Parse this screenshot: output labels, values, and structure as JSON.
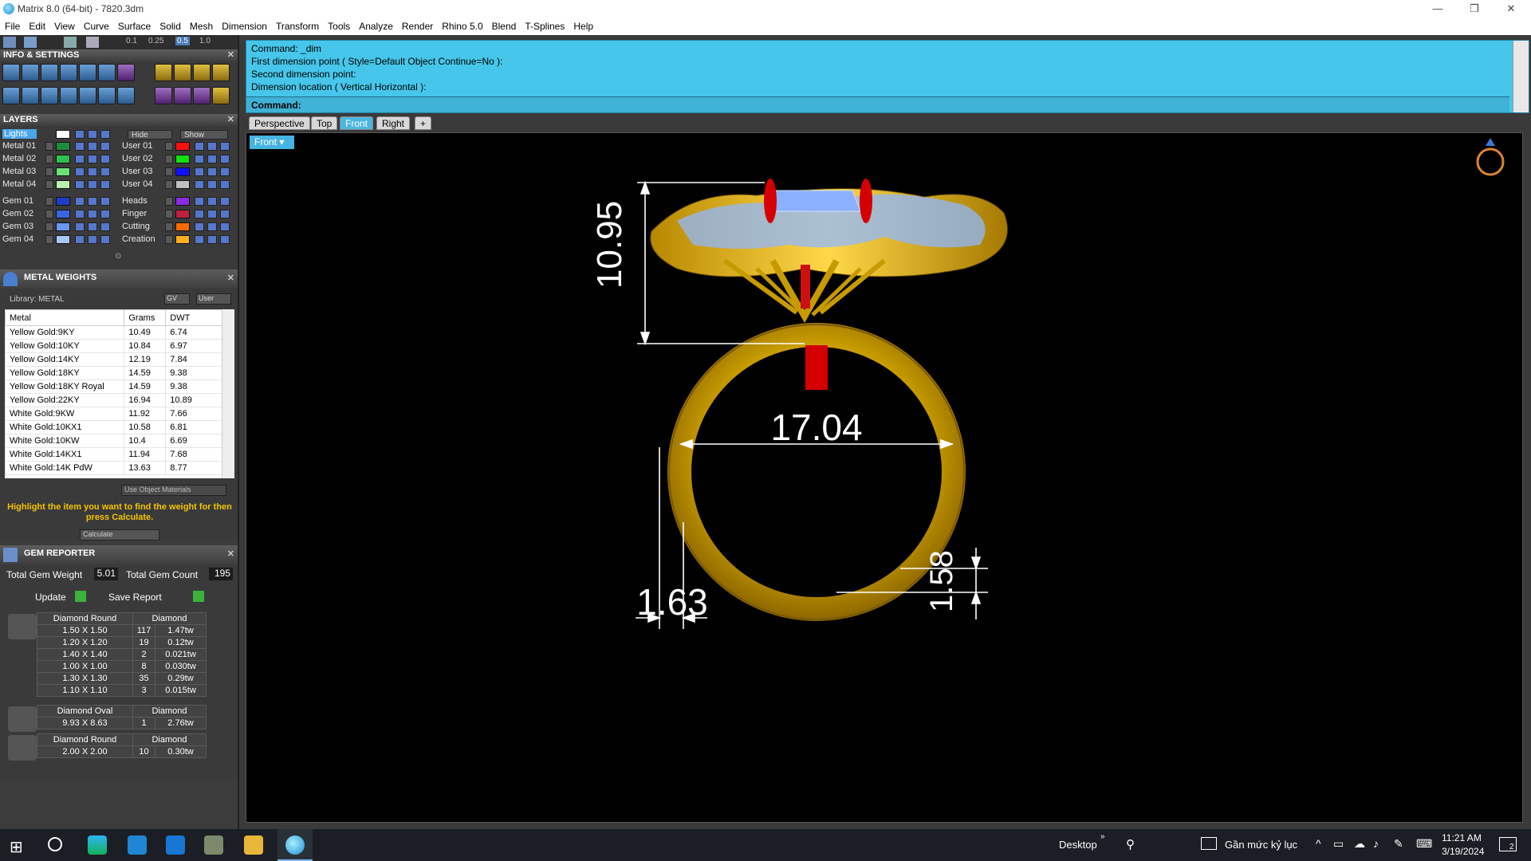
{
  "window": {
    "title": "Matrix 8.0 (64-bit) - 7820.3dm"
  },
  "menu": [
    "File",
    "Edit",
    "View",
    "Curve",
    "Surface",
    "Solid",
    "Mesh",
    "Dimension",
    "Transform",
    "Tools",
    "Analyze",
    "Render",
    "Rhino 5.0",
    "Blend",
    "T-Splines",
    "Help"
  ],
  "toolbar_values": [
    "0.1",
    "0.25",
    "0.5",
    "1.0"
  ],
  "info_settings": {
    "title": "INFO & SETTINGS"
  },
  "layers": {
    "title": "LAYERS",
    "hide_label": "Hide",
    "show_label": "Show",
    "left": [
      {
        "name": "Lights",
        "color": "#ffffff"
      },
      {
        "name": "Metal 01",
        "color": "#1e8c3c"
      },
      {
        "name": "Metal 02",
        "color": "#2fbf4f"
      },
      {
        "name": "Metal 03",
        "color": "#6ee07a"
      },
      {
        "name": "Metal 04",
        "color": "#b8f0b0"
      },
      {
        "name": "Gem 01",
        "color": "#1d3ec8"
      },
      {
        "name": "Gem 02",
        "color": "#3a64e0"
      },
      {
        "name": "Gem 03",
        "color": "#6a98f0"
      },
      {
        "name": "Gem 04",
        "color": "#a8c8f8"
      }
    ],
    "right": [
      {
        "name": "User 01",
        "color": "#ff1010"
      },
      {
        "name": "User 02",
        "color": "#12e012"
      },
      {
        "name": "User 03",
        "color": "#1010ff"
      },
      {
        "name": "User 04",
        "color": "#c0c0c0"
      },
      {
        "name": "Heads",
        "color": "#8a2be2"
      },
      {
        "name": "Finger",
        "color": "#c02040"
      },
      {
        "name": "Cutting",
        "color": "#ff6a00"
      },
      {
        "name": "Creation",
        "color": "#ffb020"
      }
    ]
  },
  "metal_weights": {
    "title": "METAL WEIGHTS",
    "library": "Library: METAL",
    "gv": "GV",
    "user": "User",
    "headers": [
      "Metal",
      "Grams",
      "DWT"
    ],
    "rows": [
      [
        "Yellow Gold:9KY",
        "10.49",
        "6.74"
      ],
      [
        "Yellow Gold:10KY",
        "10.84",
        "6.97"
      ],
      [
        "Yellow Gold:14KY",
        "12.19",
        "7.84"
      ],
      [
        "Yellow Gold:18KY",
        "14.59",
        "9.38"
      ],
      [
        "Yellow Gold:18KY Royal",
        "14.59",
        "9.38"
      ],
      [
        "Yellow Gold:22KY",
        "16.94",
        "10.89"
      ],
      [
        "White Gold:9KW",
        "11.92",
        "7.66"
      ],
      [
        "White Gold:10KX1",
        "10.58",
        "6.81"
      ],
      [
        "White Gold:10KW",
        "10.4",
        "6.69"
      ],
      [
        "White Gold:14KX1",
        "11.94",
        "7.68"
      ],
      [
        "White Gold:14K PdW",
        "13.63",
        "8.77"
      ]
    ],
    "use_object_materials": "Use Object Materials",
    "hint": "Highlight the item you want to find the weight for then press Calculate.",
    "calculate": "Calculate"
  },
  "gem_reporter": {
    "title": "GEM REPORTER",
    "total_weight_label": "Total Gem Weight",
    "total_weight": "5.01",
    "total_count_label": "Total Gem Count",
    "total_count": "195",
    "update": "Update",
    "save_report": "Save Report",
    "groups": [
      {
        "shape": "Diamond Round",
        "material": "Diamond",
        "rows": [
          [
            "1.50 X 1.50",
            "117",
            "1.47tw"
          ],
          [
            "1.20 X 1.20",
            "19",
            "0.12tw"
          ],
          [
            "1.40 X 1.40",
            "2",
            "0.021tw"
          ],
          [
            "1.00 X 1.00",
            "8",
            "0.030tw"
          ],
          [
            "1.30 X 1.30",
            "35",
            "0.29tw"
          ],
          [
            "1.10 X 1.10",
            "3",
            "0.015tw"
          ]
        ]
      },
      {
        "shape": "Diamond Oval",
        "material": "Diamond",
        "rows": [
          [
            "9.93 X 8.63",
            "1",
            "2.76tw"
          ]
        ]
      },
      {
        "shape": "Diamond Round",
        "material": "Diamond",
        "rows": [
          [
            "2.00 X 2.00",
            "10",
            "0.30tw"
          ]
        ]
      }
    ]
  },
  "command": {
    "lines": [
      "Command: _dim",
      "First dimension point ( Style=Default  Object  Continue=No ):",
      "Second dimension point:",
      "Dimension location ( Vertical  Horizontal ):"
    ],
    "prompt": "Command:"
  },
  "viewport": {
    "tabs": [
      "Perspective",
      "Top",
      "Front",
      "Right"
    ],
    "active_tab": "Front",
    "label": "Front",
    "dimensions": {
      "height": "10.95",
      "inner_diameter": "17.04",
      "thickness_bottom": "1.58",
      "shank_width": "1.63"
    }
  },
  "taskbar": {
    "desktop": "Desktop",
    "keyboard": "Gần mức kỷ lục",
    "time": "11:21 AM",
    "date": "3/19/2024",
    "notifications": "2"
  }
}
